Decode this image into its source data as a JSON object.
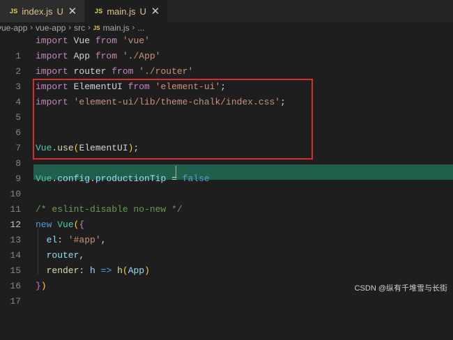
{
  "tabs": [
    {
      "badge": "JS",
      "name": "index.js",
      "status": "U",
      "close": "✕",
      "active": false
    },
    {
      "badge": "JS",
      "name": "main.js",
      "status": "U",
      "close": "✕",
      "active": true
    }
  ],
  "breadcrumb": {
    "parts": [
      "vue-app",
      "vue-app",
      "src"
    ],
    "file_badge": "JS",
    "file": "main.js",
    "more": "...",
    "separator": "›"
  },
  "editor": {
    "active_line": 12,
    "lines": [
      {
        "n": "1"
      },
      {
        "n": "2"
      },
      {
        "n": "3"
      },
      {
        "n": "4"
      },
      {
        "n": "5"
      },
      {
        "n": "6"
      },
      {
        "n": "7"
      },
      {
        "n": "8"
      },
      {
        "n": "9"
      },
      {
        "n": "10"
      },
      {
        "n": "11"
      },
      {
        "n": "12"
      },
      {
        "n": "13"
      },
      {
        "n": "14"
      },
      {
        "n": "15"
      },
      {
        "n": "16"
      },
      {
        "n": "17"
      }
    ],
    "code": {
      "l1": [
        "import",
        " Vue ",
        "from",
        " ",
        "'vue'"
      ],
      "l2": [
        "import",
        " App ",
        "from",
        " ",
        "'./App'"
      ],
      "l3": [
        "import",
        " router ",
        "from",
        " ",
        "'./router'"
      ],
      "l4": [
        "import",
        " ElementUI ",
        "from",
        " ",
        "'element-ui'",
        ";"
      ],
      "l5": [
        "import",
        " ",
        "'element-ui/lib/theme-chalk/index.css'",
        ";"
      ],
      "l8": [
        "Vue",
        ".",
        "use",
        "(",
        "ElementUI",
        ")",
        ";"
      ],
      "l10": [
        "Vue",
        ".",
        "config",
        ".",
        "productionTip",
        " = ",
        "false"
      ],
      "l12": "/* eslint-disable no-new */",
      "l13": [
        "new",
        " ",
        "Vue",
        "(",
        "{"
      ],
      "l14": [
        "  el",
        ": ",
        "'#app'",
        ","
      ],
      "l15": [
        "  router",
        ","
      ],
      "l16": [
        "  render",
        ": ",
        "h",
        " => ",
        "h",
        "(",
        "App",
        ")"
      ],
      "l17": [
        "}",
        ")"
      ]
    }
  },
  "watermark": "CSDN @纵有千堆雪与长街",
  "colors": {
    "keyword": "#c586c0",
    "string": "#ce9178",
    "comment": "#6a9955",
    "annotation_box": "#d32f2f",
    "active_line_bg": "#1f5f4c"
  }
}
